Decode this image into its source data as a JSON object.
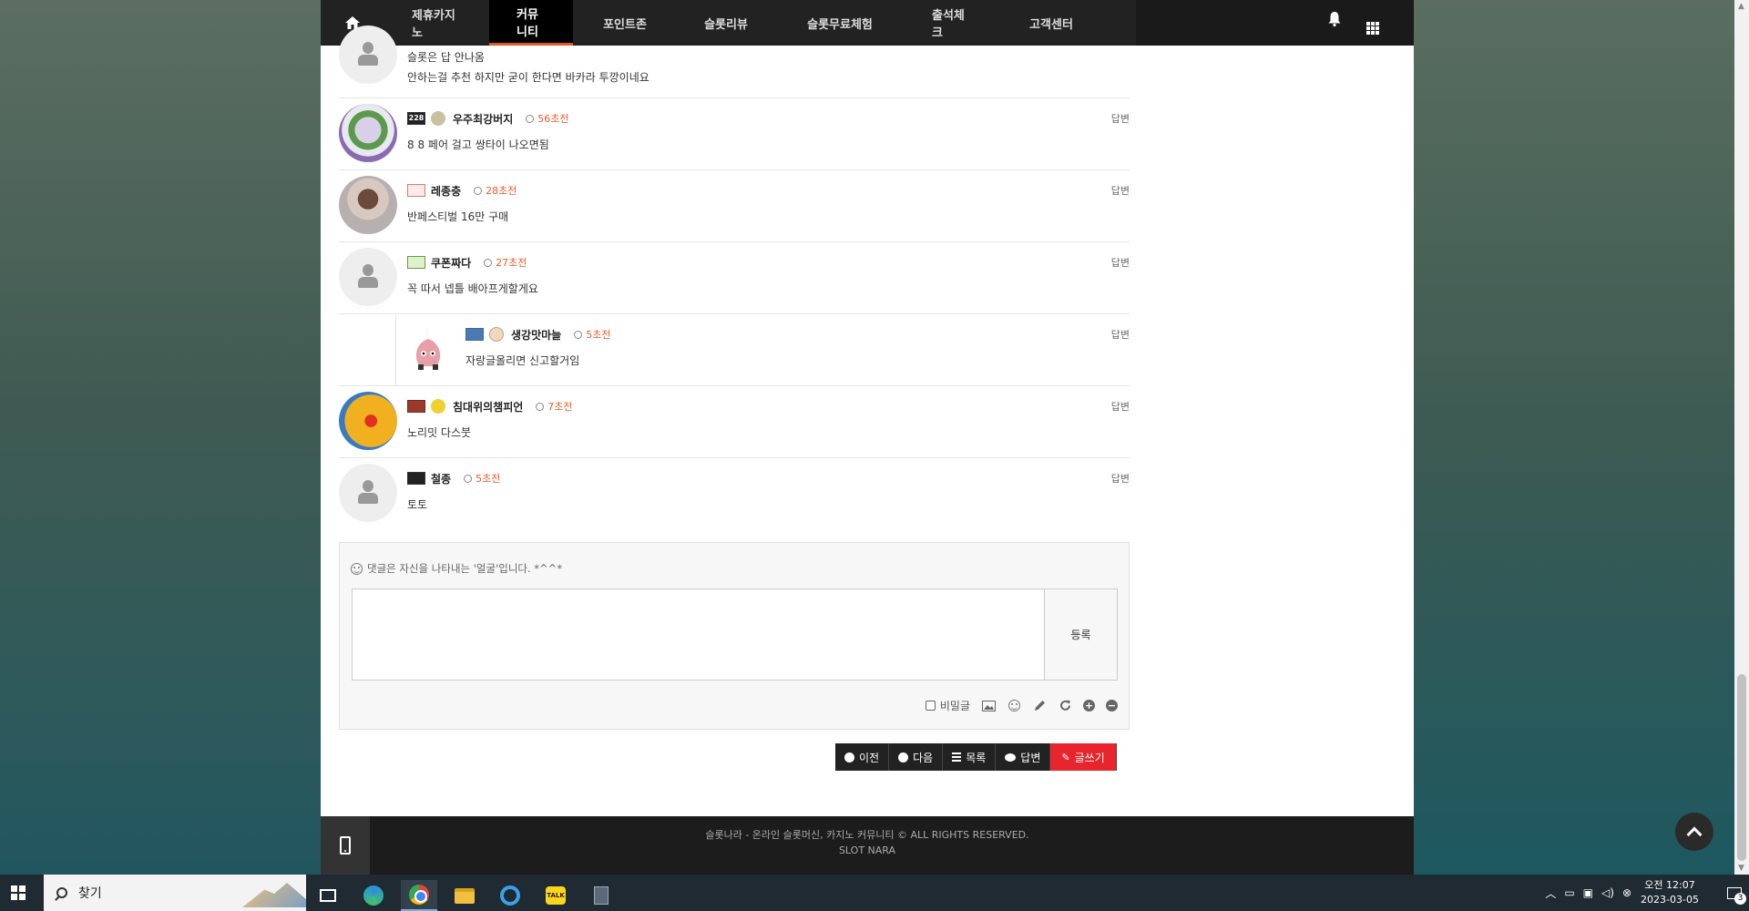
{
  "nav": {
    "items": [
      "제휴카지노",
      "커뮤니티",
      "포인트존",
      "슬롯리뷰",
      "슬롯무료체험",
      "출석체크",
      "고객센터"
    ],
    "active_index": 1
  },
  "comments": [
    {
      "badge": "",
      "nick": "",
      "time": "",
      "reply": "",
      "lines": [
        "슬롯은 답 안나옴",
        "안하는걸 추천 하지만 굳이 한다면 바카라 투깡이네요"
      ]
    },
    {
      "badge": "228",
      "nick": "우주최강버지",
      "time": "56초전",
      "reply": "답변",
      "text": "8 8 페어 걸고 쌍타이 나오면됨"
    },
    {
      "badge": "",
      "nick": "레종충",
      "time": "28초전",
      "reply": "답변",
      "text": "반페스티벌 16만 구매"
    },
    {
      "badge": "",
      "nick": "쿠폰짜다",
      "time": "27초전",
      "reply": "답변",
      "text": "꼭 따서 넵틀 배아프게할게요"
    },
    {
      "badge": "",
      "nick": "생강맛마늘",
      "time": "5초전",
      "reply": "답변",
      "text": "자랑글올리면 신고할거임"
    },
    {
      "badge": "",
      "nick": "침대위의챔피언",
      "time": "7초전",
      "reply": "답변",
      "text": "노리밋 다스붓"
    },
    {
      "badge": "",
      "nick": "철종",
      "time": "5초전",
      "reply": "답변",
      "text": "토토"
    }
  ],
  "writebox": {
    "hint": "댓글은 자신을 나타내는 '얼굴'입니다. *^^*",
    "submit": "등록",
    "secret": "비밀글"
  },
  "actions": {
    "prev": "이전",
    "next": "다음",
    "list": "목록",
    "reply": "답변",
    "write": "글쓰기"
  },
  "footer": {
    "line1": "슬롯나라 - 온라인 슬롯머신, 카지노 커뮤니티 © ALL RIGHTS RESERVED.",
    "line2": "SLOT NARA"
  },
  "taskbar": {
    "search": "찾기",
    "time": "오전 12:07",
    "date": "2023-03-05",
    "notifications": "3"
  }
}
